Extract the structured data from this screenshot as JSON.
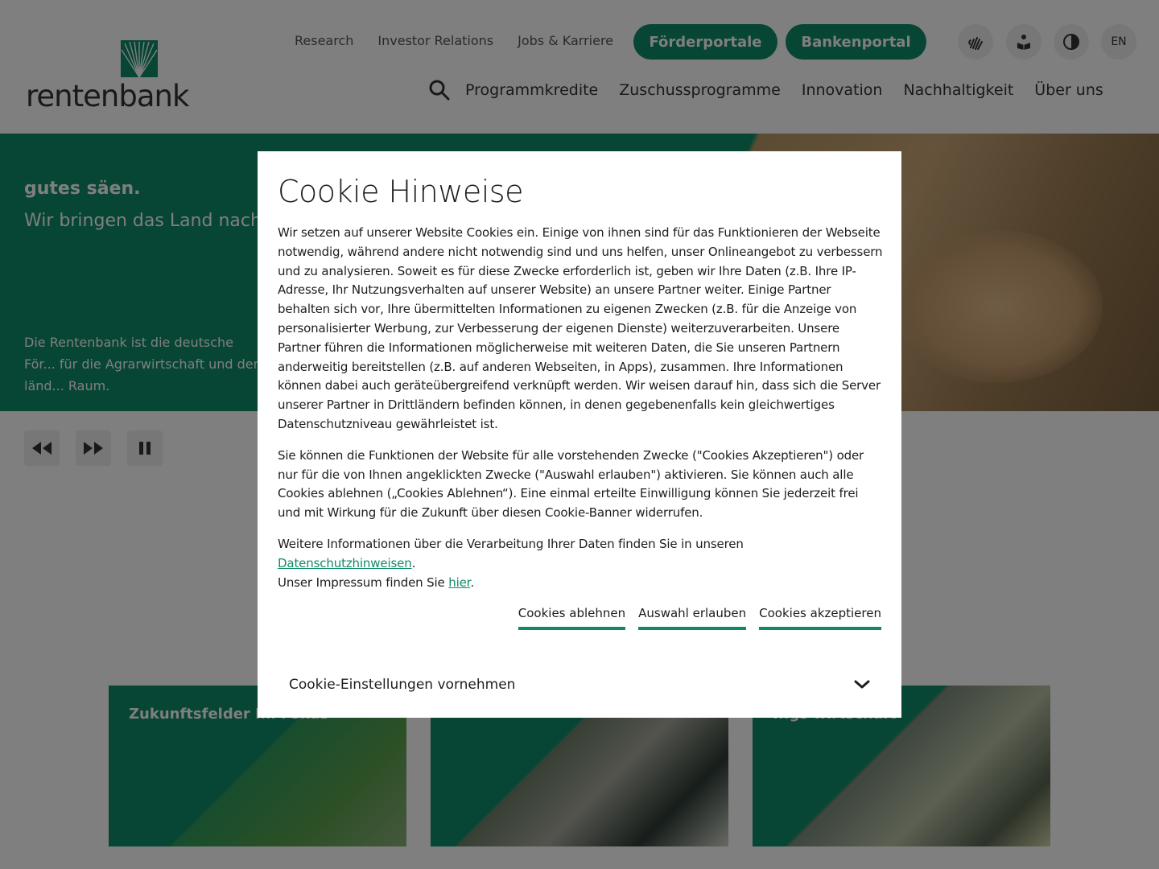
{
  "header": {
    "logo_text": "rentenbank",
    "meta_nav": [
      "Research",
      "Investor Relations",
      "Jobs & Karriere"
    ],
    "portal_buttons": [
      "Förderportale",
      "Bankenportal"
    ],
    "lang": "EN",
    "main_nav": [
      "Programmkredite",
      "Zuschussprogramme",
      "Innovation",
      "Nachhaltigkeit",
      "Über uns"
    ]
  },
  "hero": {
    "kicker": "gutes säen.",
    "title": "Wir bringen das Land nach",
    "text": "Die Rentenbank ist die deutsche För... für die Agrarwirtschaft und den länd... Raum."
  },
  "cards": [
    {
      "title": "Zukunftsfelder Im Fokus"
    },
    {
      "title": ""
    },
    {
      "title": "...gs wirtschaft"
    }
  ],
  "cookie": {
    "title": "Cookie Hinweise",
    "p1": "Wir setzen auf unserer Website Cookies ein. Einige von ihnen sind für das Funktionieren der Webseite notwendig, während andere nicht notwendig sind und uns helfen, unser Onlineangebot zu verbessern und zu analysieren. Soweit es für diese Zwecke erforderlich ist, geben wir Ihre Daten (z.B. Ihre IP-Adresse, Ihr Nutzungsverhalten auf unserer Website) an unsere Partner weiter. Einige Partner behalten sich vor, Ihre übermittelten Informationen zu eigenen Zwecken (z.B. für die Anzeige von personalisierter Werbung, zur Verbesserung der eigenen Dienste) weiterzuverarbeiten. Unsere Partner führen die Informationen möglicherweise mit weiteren Daten, die Sie unseren Partnern anderweitig bereitstellen (z.B. auf anderen Webseiten, in Apps), zusammen. Ihre Informationen können dabei auch geräteübergreifend verknüpft werden. Wir weisen darauf hin, dass sich die Server unserer Partner in Drittländern befinden können, in denen gegebenenfalls kein gleichwertiges Datenschutzniveau gewährleistet ist.",
    "p2": "Sie können die Funktionen der Website für alle vorstehenden Zwecke (\"Cookies Akzeptieren\") oder nur für die von Ihnen angeklickten Zwecke (\"Auswahl erlauben\") aktivieren. Sie können auch alle Cookies ablehnen („Cookies Ablehnen“). Eine einmal erteilte Einwilligung können Sie jederzeit frei und mit Wirkung für die Zukunft über diesen Cookie-Banner widerrufen.",
    "p3_prefix": "Weitere Informationen über die Verarbeitung Ihrer Daten finden Sie in unseren ",
    "p3_link": "Datenschutzhinweisen",
    "p3_suffix": ".",
    "p4_prefix": "Unser Impressum finden Sie ",
    "p4_link": "hier",
    "p4_suffix": ".",
    "actions": [
      "Cookies ablehnen",
      "Auswahl erlauben",
      "Cookies akzeptieren"
    ],
    "settings_label": "Cookie-Einstellungen vornehmen",
    "settings_chevron": "chevron-down-icon"
  },
  "colors": {
    "brand_green": "#0f8a68",
    "overlay": "rgba(0,0,0,0.5)"
  }
}
